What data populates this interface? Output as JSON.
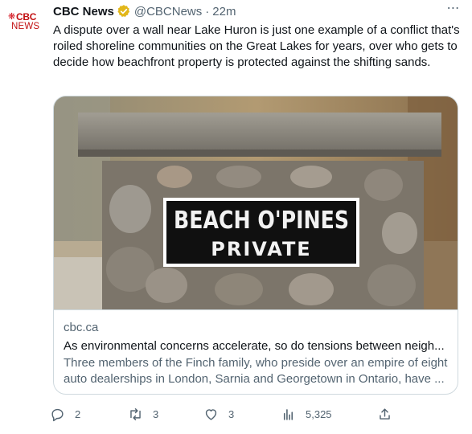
{
  "tweet": {
    "author": {
      "avatar_gem": "❋",
      "avatar_top": "CBC",
      "avatar_bottom": "NEWS",
      "name": "CBC News",
      "handle": "@CBCNews",
      "separator": "·",
      "time": "22m",
      "verified_badge_color": "#e2b719"
    },
    "more_icon": "⋯",
    "text": "A dispute over a wall near Lake Huron is just one example of a conflict that's roiled shoreline communities on the Great Lakes for years, over who gets to decide how beachfront property is protected against the shifting sands.",
    "card": {
      "image": {
        "sign_line1": "BEACH O'PINES",
        "sign_line2": "PRIVATE"
      },
      "domain": "cbc.ca",
      "title": "As environmental concerns accelerate, so do tensions between neigh...",
      "description": "Three members of the Finch family, who preside over an empire of eight auto dealerships in London, Sarnia and Georgetown in Ontario, have ..."
    },
    "actions": {
      "replies": "2",
      "retweets": "3",
      "likes": "3",
      "views": "5,325"
    }
  }
}
